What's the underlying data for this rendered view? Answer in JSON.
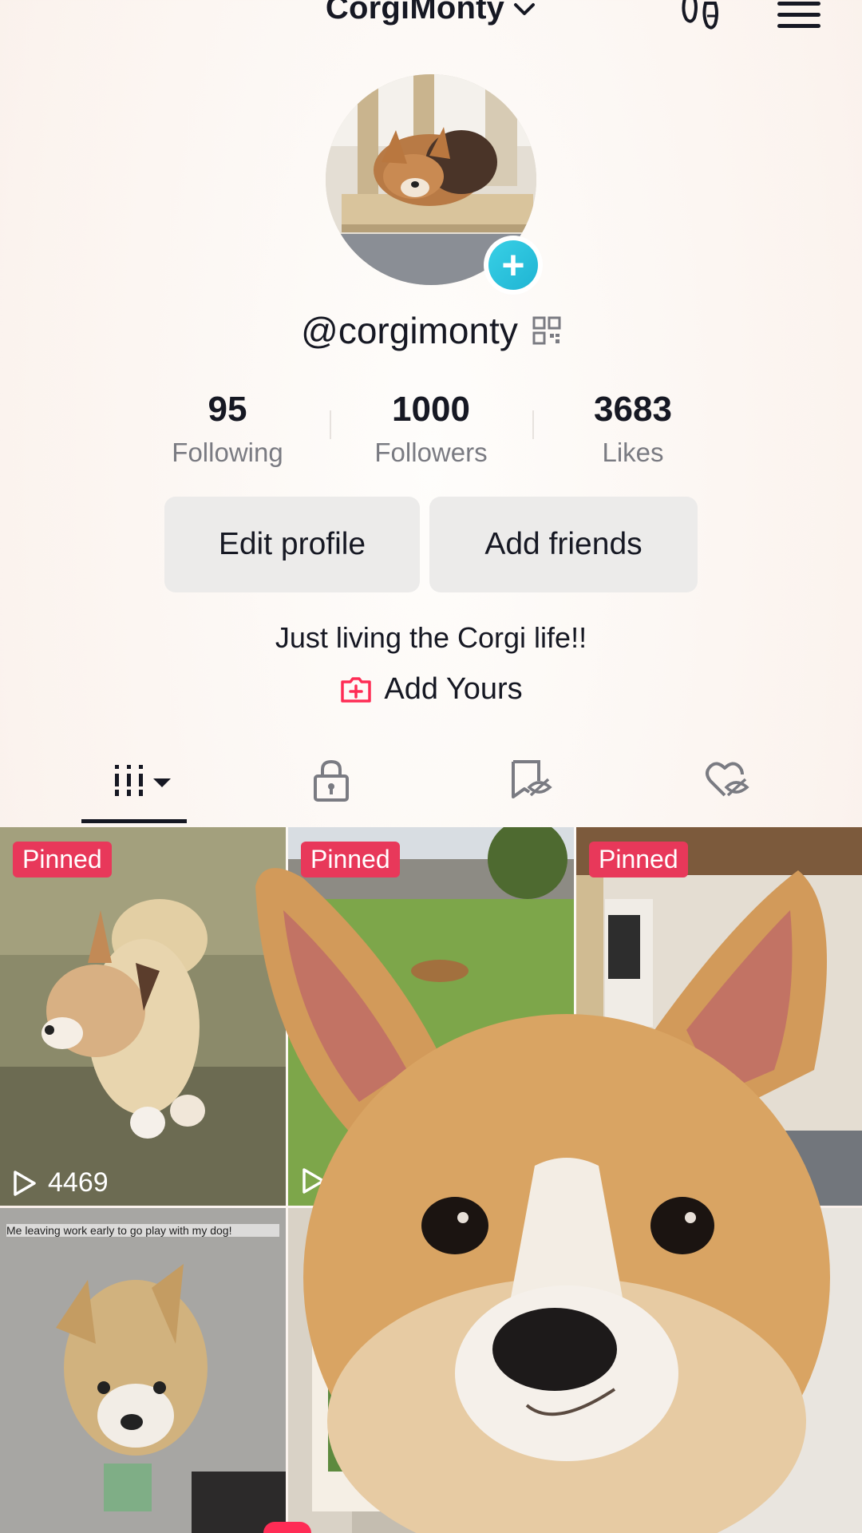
{
  "header": {
    "title": "CorgiMonty"
  },
  "profile": {
    "handle": "@corgimonty",
    "bio": "Just living the Corgi life!!",
    "add_yours": "Add Yours"
  },
  "stats": [
    {
      "value": "95",
      "label": "Following"
    },
    {
      "value": "1000",
      "label": "Followers"
    },
    {
      "value": "3683",
      "label": "Likes"
    }
  ],
  "buttons": {
    "edit_profile": "Edit profile",
    "add_friends": "Add friends"
  },
  "tabs": [
    {
      "icon": "videos-grid-icon",
      "selected": true
    },
    {
      "icon": "lock-icon",
      "selected": false
    },
    {
      "icon": "hidden-bookmark-icon",
      "selected": false
    },
    {
      "icon": "hidden-liked-icon",
      "selected": false
    }
  ],
  "grid": [
    {
      "pinned_label": "Pinned",
      "views": "4469"
    },
    {
      "pinned_label": "Pinned"
    },
    {
      "pinned_label": "Pinned"
    },
    {
      "caption": "Me leaving work early to go play with my dog!"
    },
    {}
  ],
  "colors": {
    "accent": "#fe2c55",
    "pinned": "#e8385a",
    "avatar_plus": "#20bcd6",
    "text": "#161823",
    "muted": "#7a7b82"
  }
}
